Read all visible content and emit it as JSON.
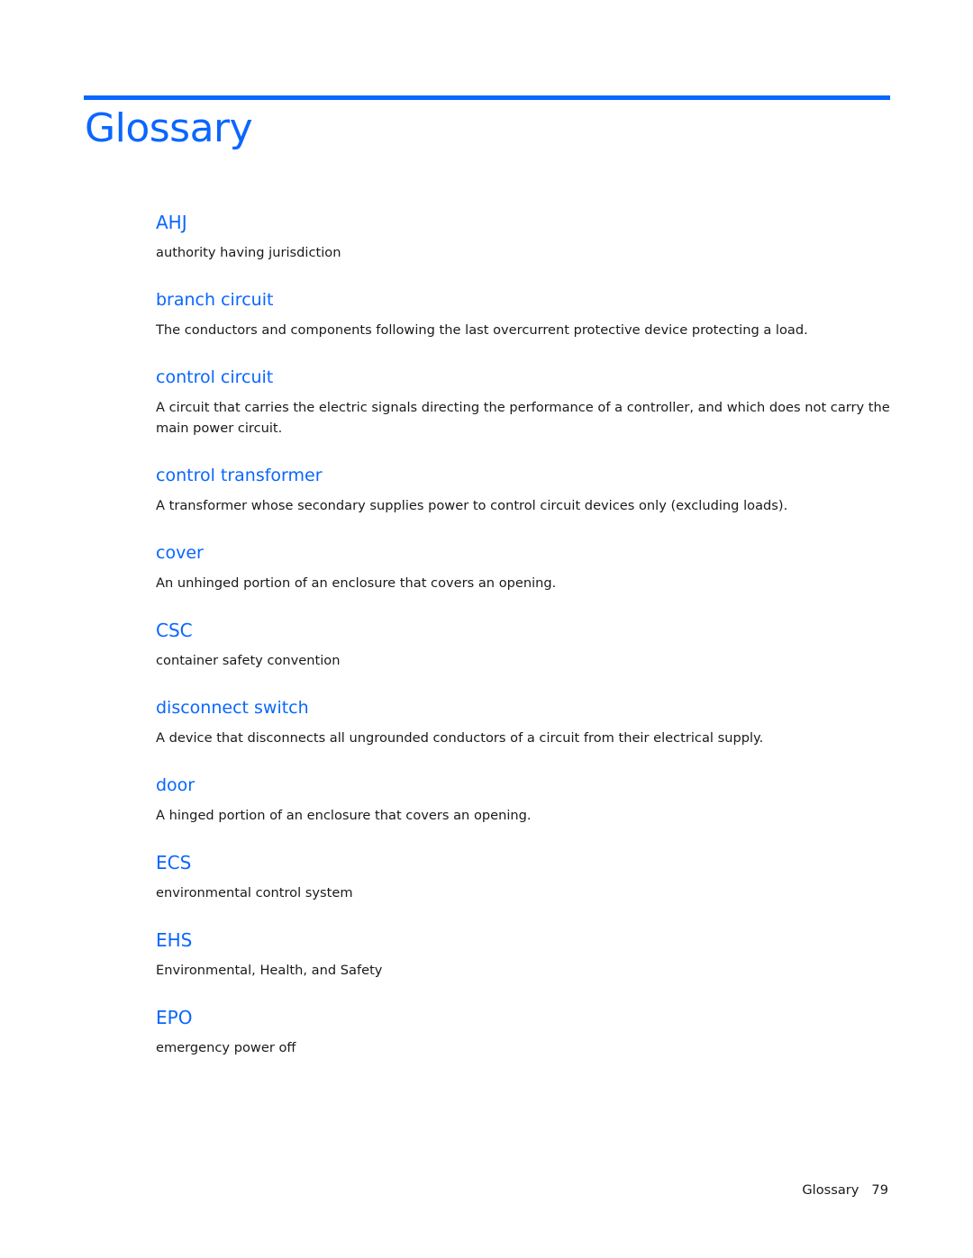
{
  "page": {
    "title": "Glossary",
    "accent_color": "#0a66ff"
  },
  "entries": [
    {
      "term": "AHJ",
      "definition": "authority having jurisdiction",
      "acronym": true
    },
    {
      "term": "branch circuit",
      "definition": "The conductors and components following the last overcurrent protective device protecting a load.",
      "acronym": false
    },
    {
      "term": "control circuit",
      "definition": "A circuit that carries the electric signals directing the performance of a controller, and which does not carry the main power circuit.",
      "acronym": false
    },
    {
      "term": "control transformer",
      "definition": "A transformer whose secondary supplies power to control circuit devices only (excluding loads).",
      "acronym": false
    },
    {
      "term": "cover",
      "definition": "An unhinged portion of an enclosure that covers an opening.",
      "acronym": false
    },
    {
      "term": "CSC",
      "definition": "container safety convention",
      "acronym": true
    },
    {
      "term": "disconnect switch",
      "definition": "A device that disconnects all ungrounded conductors of a circuit from their electrical supply.",
      "acronym": false
    },
    {
      "term": "door",
      "definition": "A hinged portion of an enclosure that covers an opening.",
      "acronym": false
    },
    {
      "term": "ECS",
      "definition": "environmental control system",
      "acronym": true
    },
    {
      "term": "EHS",
      "definition": "Environmental, Health, and Safety",
      "acronym": true
    },
    {
      "term": "EPO",
      "definition": "emergency power off",
      "acronym": true
    }
  ],
  "footer": {
    "section": "Glossary",
    "page_number": "79"
  }
}
